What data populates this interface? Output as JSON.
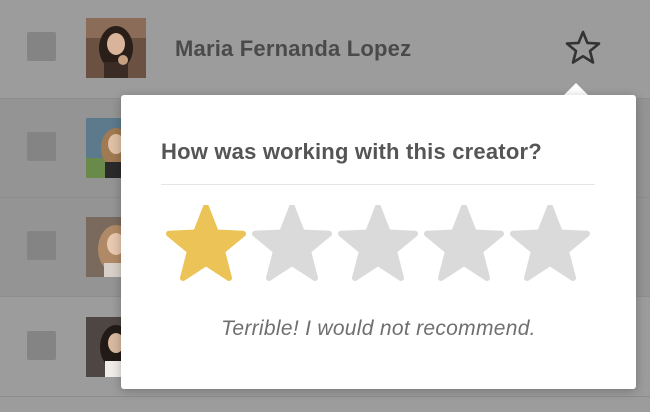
{
  "creators": [
    {
      "name": "Maria Fernanda Lopez",
      "checked": false
    },
    {
      "name": "",
      "checked": false
    },
    {
      "name": "",
      "checked": false
    },
    {
      "name": "",
      "checked": false
    }
  ],
  "favorite_icon": "star-outline-icon",
  "rating_popover": {
    "question": "How was working with this creator?",
    "rating": 1,
    "max_rating": 5,
    "rating_text": "Terrible! I would not recommend.",
    "filled_color": "#ecc356",
    "empty_color": "#dadada"
  }
}
